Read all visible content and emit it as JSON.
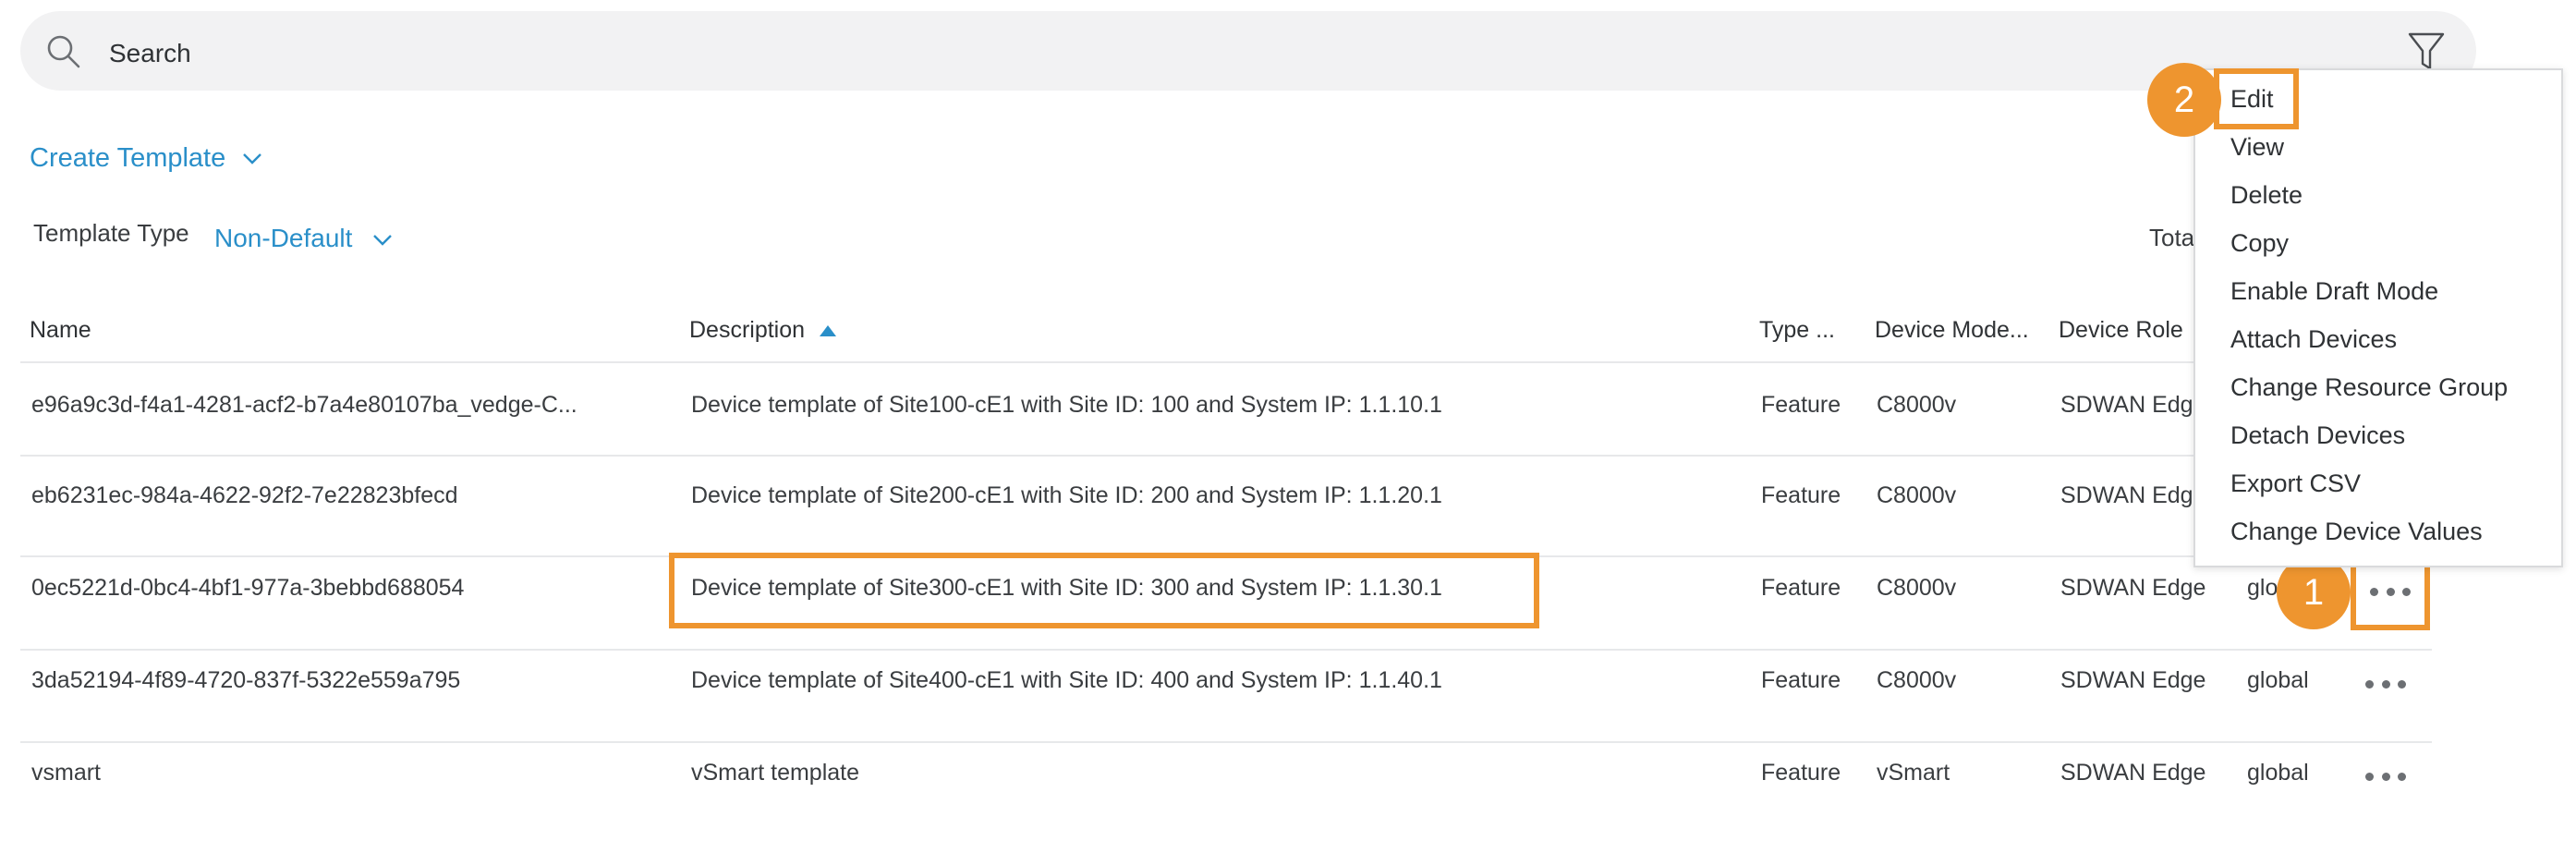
{
  "search": {
    "label": "Search"
  },
  "toolbar": {
    "create_template_label": "Create Template"
  },
  "filter": {
    "template_type_label": "Template Type",
    "template_type_value": "Non-Default",
    "total_label": "Tota"
  },
  "table": {
    "headers": [
      "Name",
      "Description",
      "Type ...",
      "Device Mode...",
      "Device Role"
    ],
    "rows": [
      {
        "name": "e96a9c3d-f4a1-4281-acf2-b7a4e80107ba_vedge-C...",
        "description": "Device template of Site100-cE1 with Site ID: 100 and System IP: 1.1.10.1",
        "type": "Feature",
        "model": "C8000v",
        "role": "SDWAN Edge",
        "resource_group": ""
      },
      {
        "name": "eb6231ec-984a-4622-92f2-7e22823bfecd",
        "description": "Device template of Site200-cE1 with Site ID: 200 and System IP: 1.1.20.1",
        "type": "Feature",
        "model": "C8000v",
        "role": "SDWAN Edg",
        "resource_group": ""
      },
      {
        "name": "0ec5221d-0bc4-4bf1-977a-3bebbd688054",
        "description": "Device template of Site300-cE1 with Site ID: 300 and System IP: 1.1.30.1",
        "type": "Feature",
        "model": "C8000v",
        "role": "SDWAN Edge",
        "resource_group": "glo"
      },
      {
        "name": "3da52194-4f89-4720-837f-5322e559a795",
        "description": "Device template of Site400-cE1 with Site ID: 400 and System IP: 1.1.40.1",
        "type": "Feature",
        "model": "C8000v",
        "role": "SDWAN Edge",
        "resource_group": "global"
      },
      {
        "name": "vsmart",
        "description": "vSmart template",
        "type": "Feature",
        "model": "vSmart",
        "role": "SDWAN Edge",
        "resource_group": "global"
      }
    ]
  },
  "menu": {
    "items": [
      "Edit",
      "View",
      "Delete",
      "Copy",
      "Enable Draft Mode",
      "Attach Devices",
      "Change Resource Group",
      "Detach Devices",
      "Export CSV",
      "Change Device Values"
    ]
  },
  "annotations": {
    "step1": "1",
    "step2": "2"
  },
  "colors": {
    "accent": "#2a8fc9",
    "highlight": "#ee952f"
  }
}
